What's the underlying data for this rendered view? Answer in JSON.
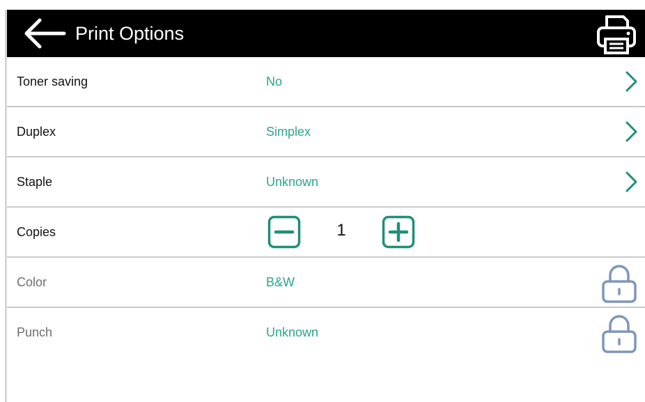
{
  "header": {
    "title": "Print Options"
  },
  "colors": {
    "header_bg": "#000000",
    "value_text": "#2aa58e",
    "stepper": "#1f8f78",
    "lock_icon": "#7f96b9",
    "divider": "#c9c9c9"
  },
  "options": [
    {
      "label": "Toner saving",
      "value": "No",
      "action": "chevron-right-icon"
    },
    {
      "label": "Duplex",
      "value": "Simplex",
      "action": "chevron-right-icon"
    },
    {
      "label": "Staple",
      "value": "Unknown",
      "action": "chevron-right-icon"
    },
    {
      "label": "Copies",
      "value": "1",
      "action": "stepper"
    },
    {
      "label": "Color",
      "value": "B&W",
      "action": "lock-icon",
      "locked": true
    },
    {
      "label": "Punch",
      "value": "Unknown",
      "action": "lock-icon",
      "locked": true
    }
  ]
}
